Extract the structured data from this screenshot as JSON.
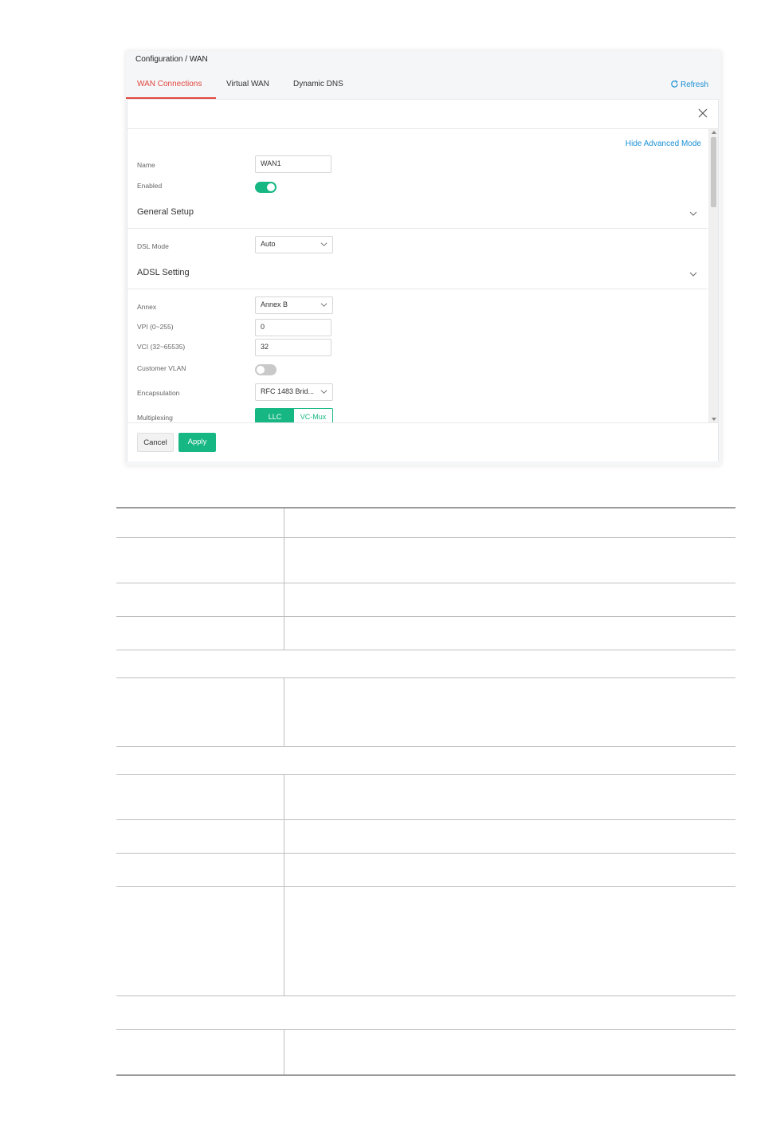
{
  "breadcrumb": "Configuration / WAN",
  "tabs": [
    "WAN Connections",
    "Virtual WAN",
    "Dynamic DNS"
  ],
  "refresh_label": "Refresh",
  "dialog": {
    "advanced_link": "Hide Advanced Mode",
    "name_label": "Name",
    "name_value": "WAN1",
    "enabled_label": "Enabled",
    "enabled": true,
    "general_setup": "General Setup",
    "dsl_mode_label": "DSL Mode",
    "dsl_mode_value": "Auto",
    "adsl_setting": "ADSL Setting",
    "annex_label": "Annex",
    "annex_value": "Annex B",
    "vpi_label": "VPI (0~255)",
    "vpi_value": "0",
    "vci_label": "VCI (32~65535)",
    "vci_value": "32",
    "customer_vlan_label": "Customer VLAN",
    "customer_vlan": false,
    "encapsulation_label": "Encapsulation",
    "encapsulation_value": "RFC 1483 Brid...",
    "multiplexing_label": "Multiplexing",
    "multiplexing_options": [
      "LLC",
      "VC-Mux"
    ],
    "multiplexing_selected": "LLC"
  },
  "footer": {
    "cancel": "Cancel",
    "apply": "Apply"
  },
  "colors": {
    "accent_green": "#17b784",
    "tab_active_red": "#e2463f",
    "link_blue": "#1a8fd6"
  }
}
